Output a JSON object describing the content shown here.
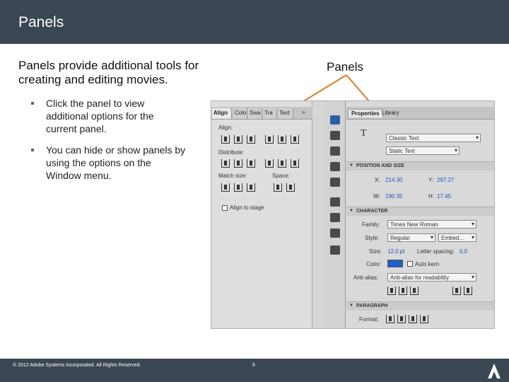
{
  "slide": {
    "title": "Panels",
    "intro": "Panels provide additional tools for creating and editing movies.",
    "callout_label": "Panels",
    "bullets": [
      "Click the panel to view additional options for the current panel.",
      "You can hide or show panels by using the options on the Window menu."
    ],
    "footer_copyright": "© 2012 Adobe Systems Incorporated. All Rights Reserved.",
    "page_number": "6",
    "arrow_color": "#e07b20"
  },
  "align_panel": {
    "tabs": [
      "Align",
      "Colo",
      "Swa",
      "Tra",
      "Text"
    ],
    "align_label": "Align:",
    "distribute_label": "Distribute:",
    "match_size_label": "Match size:",
    "space_label": "Space:",
    "align_to_stage": "Align to stage",
    "collapse_glyph": "»"
  },
  "properties_panel": {
    "tabs": [
      "Properties",
      "Library"
    ],
    "text_tool_glyph": "T",
    "text_type": "Classic Text",
    "text_mode": "Static Text",
    "sections": {
      "position": "POSITION AND SIZE",
      "character": "CHARACTER",
      "paragraph": "PARAGRAPH"
    },
    "x_label": "X:",
    "x_value": "214.30",
    "y_label": "Y:",
    "y_value": "297.27",
    "w_label": "W:",
    "w_value": "190.35",
    "h_label": "H:",
    "h_value": "17.45",
    "family_label": "Family:",
    "family_value": "Times New Roman",
    "style_label": "Style:",
    "style_value": "Regular",
    "embed_label": "Embed...",
    "size_label": "Size:",
    "size_value": "12.0 pt",
    "letter_spacing_label": "Letter spacing:",
    "letter_spacing_value": "0.0",
    "color_label": "Color:",
    "color_value": "#1f5fc8",
    "auto_kern_label": "Auto kern",
    "anti_alias_label": "Anti-alias:",
    "anti_alias_value": "Anti-alias for readability",
    "format_label": "Format:"
  }
}
